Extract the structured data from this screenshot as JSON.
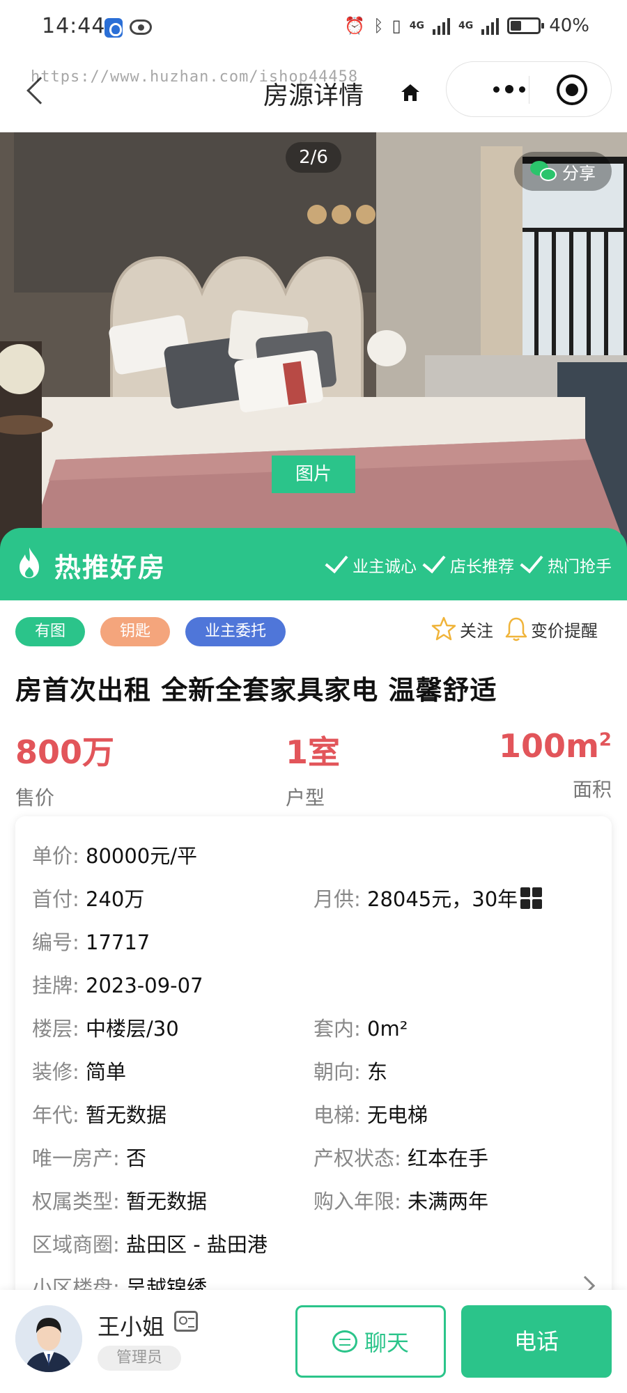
{
  "status_bar": {
    "time": "14:44",
    "network_1": "4G",
    "network_2": "4G",
    "battery_text": "40%",
    "battery_level": 0.4
  },
  "nav": {
    "title": "房源详情",
    "watermark": "https://www.huzhan.com/ishop44458"
  },
  "gallery": {
    "counter": "2/6",
    "share_label": "分享",
    "photo_tab_label": "图片"
  },
  "hot_banner": {
    "title": "热推好房",
    "tags": [
      "业主诚心",
      "店长推荐",
      "热门抢手"
    ]
  },
  "tags": [
    {
      "label": "有图",
      "color": "#2bc48a"
    },
    {
      "label": "钥匙",
      "color": "#f4a57c"
    },
    {
      "label": "业主委托",
      "color": "#4f76d9"
    }
  ],
  "actions": {
    "follow_label": "关注",
    "price_alert_label": "变价提醒"
  },
  "listing": {
    "title": "房首次出租 全新全套家具家电 温馨舒适",
    "price_value": "800万",
    "price_label": "售价",
    "layout_value": "1室",
    "layout_label": "户型",
    "area_value": "100m",
    "area_unit_sup": "2",
    "area_label": "面积"
  },
  "details": {
    "unit_price": {
      "key": "单价:",
      "value": "80000元/平"
    },
    "down_payment": {
      "key": "首付:",
      "value": "240万"
    },
    "monthly": {
      "key": "月供:",
      "value": "28045元，30年"
    },
    "code": {
      "key": "编号:",
      "value": "17717"
    },
    "listed": {
      "key": "挂牌:",
      "value": "2023-09-07"
    },
    "floor": {
      "key": "楼层:",
      "value": "中楼层/30"
    },
    "inner_area": {
      "key": "套内:",
      "value": "0m²"
    },
    "decoration": {
      "key": "装修:",
      "value": "简单"
    },
    "orientation": {
      "key": "朝向:",
      "value": "东"
    },
    "year": {
      "key": "年代:",
      "value": "暂无数据"
    },
    "elevator": {
      "key": "电梯:",
      "value": "无电梯"
    },
    "only_home": {
      "key": "唯一房产:",
      "value": "否"
    },
    "title_status": {
      "key": "产权状态:",
      "value": "红本在手"
    },
    "ownership_type": {
      "key": "权属类型:",
      "value": "暂无数据"
    },
    "years_held": {
      "key": "购入年限:",
      "value": "未满两年"
    },
    "district": {
      "key": "区域商圈:",
      "value": "盐田区 - 盐田港"
    },
    "community": {
      "key": "小区楼盘:",
      "value": "吴越锦绣"
    }
  },
  "agent": {
    "name": "王小姐",
    "role": "管理员",
    "chat_label": "聊天",
    "call_label": "电话"
  },
  "colors": {
    "brand_green": "#2bc48a",
    "price_red": "#e2555a"
  }
}
